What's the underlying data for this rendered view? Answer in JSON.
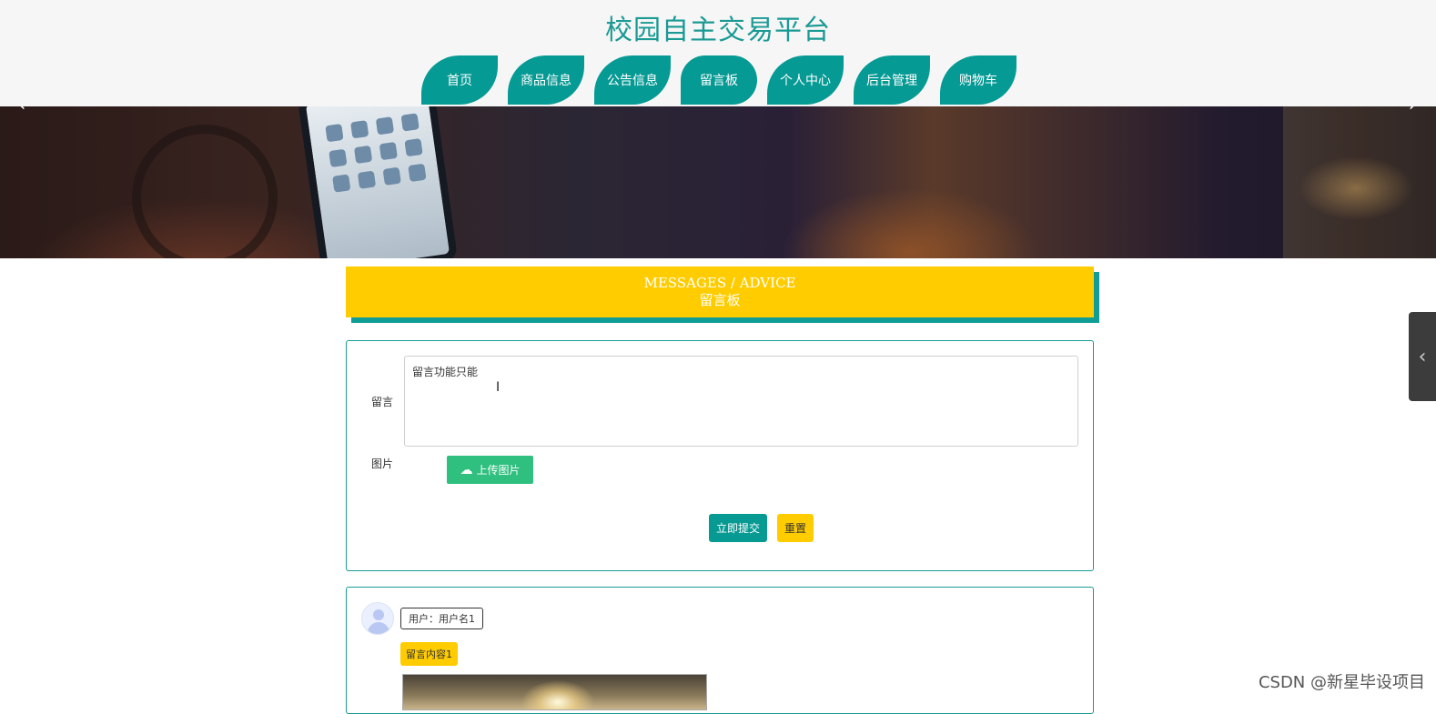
{
  "header": {
    "site_title": "校园自主交易平台",
    "nav": [
      {
        "label": "首页"
      },
      {
        "label": "商品信息"
      },
      {
        "label": "公告信息"
      },
      {
        "label": "留言板"
      },
      {
        "label": "个人中心"
      },
      {
        "label": "后台管理"
      },
      {
        "label": "购物车"
      }
    ],
    "active_nav": "留言板"
  },
  "banner": {
    "prev_icon": "‹",
    "next_icon": "›"
  },
  "section_title": {
    "en": "MESSAGES / ADVICE",
    "zh": "留言板"
  },
  "form": {
    "message_label": "留言",
    "message_value": "留言功能只能",
    "image_label": "图片",
    "upload_label": "上传图片",
    "submit_label": "立即提交",
    "reset_label": "重置"
  },
  "messages": [
    {
      "user": "用户：用户名1",
      "content": "留言内容1"
    }
  ],
  "side_toggle_icon": "‹",
  "watermark": "CSDN @新星毕设项目",
  "colors": {
    "teal": "#069a94",
    "yellow": "#ffcc00",
    "green": "#2fbf7f"
  }
}
